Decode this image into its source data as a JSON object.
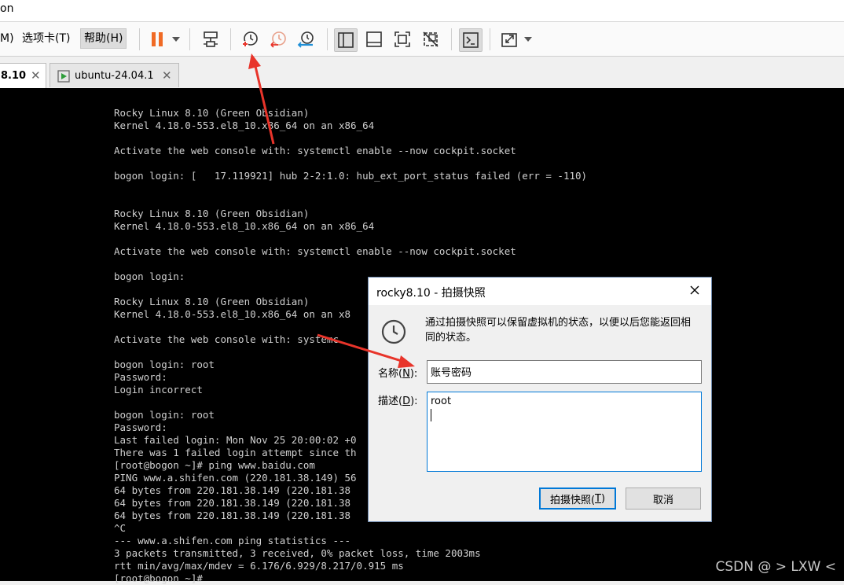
{
  "window": {
    "title_fragment": "on"
  },
  "menu": [
    {
      "label": "M)"
    },
    {
      "label": "选项卡(T)"
    },
    {
      "label": "帮助(H)"
    }
  ],
  "toolbar_icons": [
    "pause-icon",
    "send-ctrl-alt-del-icon",
    "take-snapshot-icon",
    "revert-snapshot-icon",
    "snapshot-manager-icon",
    "sidebar-view-icon",
    "console-view-icon",
    "fullscreen-icon",
    "unity-icon",
    "terminal-icon",
    "stretch-icon"
  ],
  "tabs": [
    {
      "label": "8.10",
      "close": "✕"
    },
    {
      "label": "ubuntu-24.04.1",
      "close": "✕"
    }
  ],
  "console_lines": [
    "Rocky Linux 8.10 (Green Obsidian)",
    "Kernel 4.18.0-553.el8_10.x86_64 on an x86_64",
    "",
    "Activate the web console with: systemctl enable --now cockpit.socket",
    "",
    "bogon login: [   17.119921] hub 2-2:1.0: hub_ext_port_status failed (err = -110)",
    "",
    "",
    "Rocky Linux 8.10 (Green Obsidian)",
    "Kernel 4.18.0-553.el8_10.x86_64 on an x86_64",
    "",
    "Activate the web console with: systemctl enable --now cockpit.socket",
    "",
    "bogon login:",
    "",
    "Rocky Linux 8.10 (Green Obsidian)",
    "Kernel 4.18.0-553.el8_10.x86_64 on an x8",
    "",
    "Activate the web console with: systemc",
    "",
    "bogon login: root",
    "Password:",
    "Login incorrect",
    "",
    "bogon login: root",
    "Password:",
    "Last failed login: Mon Nov 25 20:00:02 +0",
    "There was 1 failed login attempt since th",
    "[root@bogon ~]# ping www.baidu.com",
    "PING www.a.shifen.com (220.181.38.149) 56",
    "64 bytes from 220.181.38.149 (220.181.38",
    "64 bytes from 220.181.38.149 (220.181.38",
    "64 bytes from 220.181.38.149 (220.181.38",
    "^C",
    "--- www.a.shifen.com ping statistics ---",
    "3 packets transmitted, 3 received, 0% packet loss, time 2003ms",
    "rtt min/avg/max/mdev = 6.176/6.929/8.217/0.915 ms",
    "[root@bogon ~]#"
  ],
  "dialog": {
    "title": "rocky8.10 - 拍摄快照",
    "info": "通过拍摄快照可以保留虚拟机的状态，以便以后您能返回相同的状态。",
    "name_label_pre": "名称(",
    "name_label_key": "N",
    "name_label_post": "):",
    "name_value": "账号密码",
    "desc_label_pre": "描述(",
    "desc_label_key": "D",
    "desc_label_post": "):",
    "desc_value": "root",
    "ok_pre": "拍摄快照(",
    "ok_key": "T",
    "ok_post": ")",
    "cancel": "取消"
  },
  "watermark": "CSDN @ > LXW <",
  "colors": {
    "console_bg": "#000000",
    "console_text": "#d0d0d0",
    "accent": "#0078d7",
    "arrow": "#e8342a",
    "pause": "#f06a25"
  }
}
